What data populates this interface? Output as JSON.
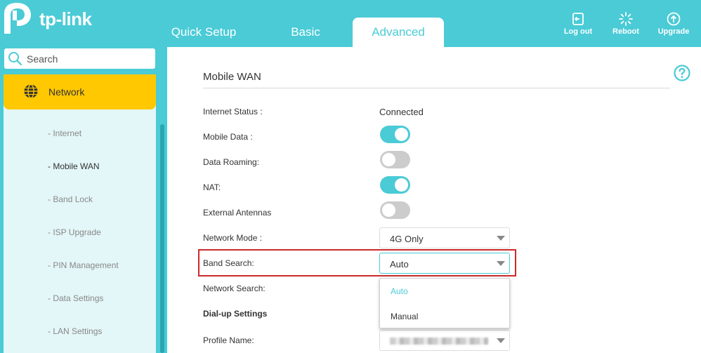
{
  "brand": {
    "name": "tp-link",
    "color": "#4acbd6",
    "accent": "#ffc800"
  },
  "tabs": [
    {
      "label": "Quick Setup"
    },
    {
      "label": "Basic"
    },
    {
      "label": "Advanced"
    }
  ],
  "header_actions": [
    {
      "label": "Log out",
      "icon": "logout-icon"
    },
    {
      "label": "Reboot",
      "icon": "reboot-icon"
    },
    {
      "label": "Upgrade",
      "icon": "upgrade-icon"
    }
  ],
  "sidebar": {
    "search_placeholder": "Search",
    "section": "Network",
    "items": [
      {
        "label": "- Internet"
      },
      {
        "label": "- Mobile WAN"
      },
      {
        "label": "- Band Lock"
      },
      {
        "label": "- ISP Upgrade"
      },
      {
        "label": "- PIN Management"
      },
      {
        "label": "- Data Settings"
      },
      {
        "label": "- LAN Settings"
      }
    ]
  },
  "main": {
    "title": "Mobile WAN",
    "internet_status_label": "Internet Status :",
    "internet_status_value": "Connected",
    "mobile_data_label": "Mobile Data :",
    "mobile_data_on": true,
    "data_roaming_label": "Data Roaming:",
    "data_roaming_on": false,
    "nat_label": "NAT:",
    "nat_on": true,
    "external_antennas_label": "External Antennas",
    "external_antennas_on": false,
    "network_mode_label": "Network Mode :",
    "network_mode_value": "4G Only",
    "band_search_label": "Band Search:",
    "band_search_value": "Auto",
    "band_search_options": [
      "Auto",
      "Manual"
    ],
    "network_search_label": "Network Search:",
    "dialup_heading": "Dial-up Settings",
    "profile_name_label": "Profile Name:"
  }
}
